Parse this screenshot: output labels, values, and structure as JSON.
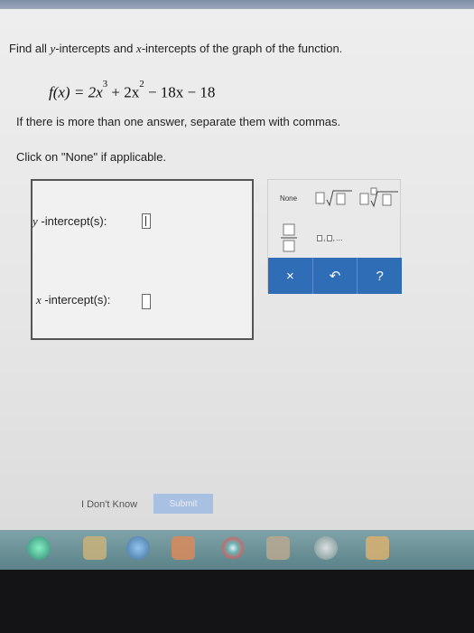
{
  "question": {
    "prefix": "Find all ",
    "y_var": "y",
    "middle": "-intercepts and ",
    "x_var": "x",
    "suffix": "-intercepts of the graph of the function."
  },
  "formula": {
    "lhs": "f(x) = 2x",
    "exp1": "3",
    "mid": " + 2x",
    "exp2": "2",
    "tail": " − 18x − 18"
  },
  "instructions": {
    "line1": "If there is more than one answer, separate them with commas.",
    "line2": "Click on \"None\" if applicable."
  },
  "answer_fields": {
    "y_var": "y",
    "y_label": " -intercept(s):",
    "x_var": "x",
    "x_label": " -intercept(s):"
  },
  "palette": {
    "none_label": "None",
    "list_sep": ",",
    "list_ellipsis": "...",
    "clear_label": "×",
    "undo_label": "↶",
    "help_label": "?"
  },
  "footer": {
    "dont_know": "I Don't Know",
    "submit": "Submit"
  },
  "colors": {
    "palette_bar": "#2f6db7",
    "submit_disabled": "#a8c0e2"
  },
  "taskbar": {
    "icons": [
      "start-icon",
      "file-explorer-icon",
      "ie-icon",
      "media-icon",
      "chrome-icon",
      "calculator-icon",
      "app-icon",
      "office-icon"
    ]
  }
}
